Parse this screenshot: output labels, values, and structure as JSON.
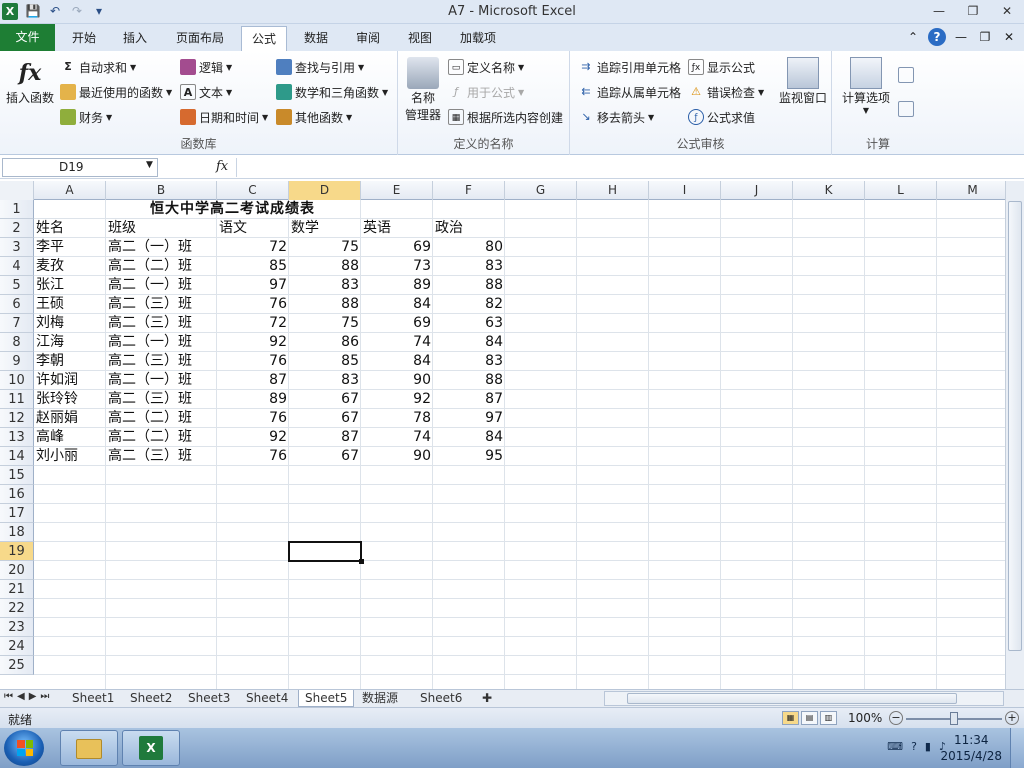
{
  "window": {
    "title": "A7  -  Microsoft Excel",
    "app_letter": "X",
    "qat": {
      "save": "💾",
      "undo": "↶",
      "redo": "↷",
      "customize": "▾"
    },
    "controls": {
      "minimize": "—",
      "restore": "❐",
      "close": "✕"
    }
  },
  "tabs": {
    "file": "文件",
    "items": [
      "开始",
      "插入",
      "页面布局",
      "公式",
      "数据",
      "审阅",
      "视图",
      "加载项"
    ],
    "active": "公式",
    "right": {
      "collapse": "⌃",
      "help": "?",
      "min": "—",
      "restore": "❐",
      "close": "✕"
    }
  },
  "ribbon": {
    "function_library": {
      "label": "函数库",
      "insert_function": "插入函数",
      "autosum": "自动求和",
      "recent": "最近使用的函数",
      "financial": "财务",
      "logical": "逻辑",
      "text": "文本",
      "datetime": "日期和时间",
      "lookup": "查找与引用",
      "math": "数学和三角函数",
      "more": "其他函数"
    },
    "defined_names": {
      "label": "定义的名称",
      "name_manager_1": "名称",
      "name_manager_2": "管理器",
      "define_name": "定义名称",
      "use_in_formula": "用于公式",
      "create_from_selection": "根据所选内容创建"
    },
    "formula_auditing": {
      "label": "公式审核",
      "trace_precedents": "追踪引用单元格",
      "trace_dependents": "追踪从属单元格",
      "remove_arrows": "移去箭头",
      "show_formulas": "显示公式",
      "error_checking": "错误检查",
      "evaluate": "公式求值",
      "watch_window": "监视窗口"
    },
    "calculation": {
      "label": "计算",
      "options": "计算选项"
    }
  },
  "formula_bar": {
    "name_box": "D19",
    "fx": "fx",
    "content": ""
  },
  "columns": [
    "A",
    "B",
    "C",
    "D",
    "E",
    "F",
    "G",
    "H",
    "I",
    "J",
    "K",
    "L",
    "M"
  ],
  "rows": [
    "1",
    "2",
    "3",
    "4",
    "5",
    "6",
    "7",
    "8",
    "9",
    "10",
    "11",
    "12",
    "13",
    "14",
    "15",
    "16",
    "17",
    "18",
    "19",
    "20",
    "21",
    "22",
    "23",
    "24",
    "25"
  ],
  "selected": {
    "column": "D",
    "row": "19"
  },
  "sheet": {
    "title": "恒大中学高二考试成绩表",
    "headers": [
      "姓名",
      "班级",
      "语文",
      "数学",
      "英语",
      "政治"
    ],
    "records": [
      [
        "李平",
        "高二（一）班",
        "72",
        "75",
        "69",
        "80"
      ],
      [
        "麦孜",
        "高二（二）班",
        "85",
        "88",
        "73",
        "83"
      ],
      [
        "张江",
        "高二（一）班",
        "97",
        "83",
        "89",
        "88"
      ],
      [
        "王硕",
        "高二（三）班",
        "76",
        "88",
        "84",
        "82"
      ],
      [
        "刘梅",
        "高二（三）班",
        "72",
        "75",
        "69",
        "63"
      ],
      [
        "江海",
        "高二（一）班",
        "92",
        "86",
        "74",
        "84"
      ],
      [
        "李朝",
        "高二（三）班",
        "76",
        "85",
        "84",
        "83"
      ],
      [
        "许如润",
        "高二（一）班",
        "87",
        "83",
        "90",
        "88"
      ],
      [
        "张玲铃",
        "高二（三）班",
        "89",
        "67",
        "92",
        "87"
      ],
      [
        "赵丽娟",
        "高二（二）班",
        "76",
        "67",
        "78",
        "97"
      ],
      [
        "高峰",
        "高二（二）班",
        "92",
        "87",
        "74",
        "84"
      ],
      [
        "刘小丽",
        "高二（三）班",
        "76",
        "67",
        "90",
        "95"
      ]
    ]
  },
  "sheet_tabs": {
    "nav": "⏮◀▶⏭",
    "items": [
      "Sheet1",
      "Sheet2",
      "Sheet3",
      "Sheet4",
      "Sheet5",
      "数据源",
      "Sheet6"
    ],
    "active": "Sheet5",
    "insert": "✚"
  },
  "status": {
    "text": "就绪",
    "zoom": "100%",
    "zoom_value_percent": 100,
    "minus": "−",
    "plus": "+"
  },
  "taskbar": {
    "time": "11:34",
    "date": "2015/4/28",
    "excel_letter": "X"
  },
  "colors": {
    "accent_green": "#1e7e34",
    "selection_yellow": "#f7d98a",
    "ribbon_blue": "#dfe8f4"
  }
}
